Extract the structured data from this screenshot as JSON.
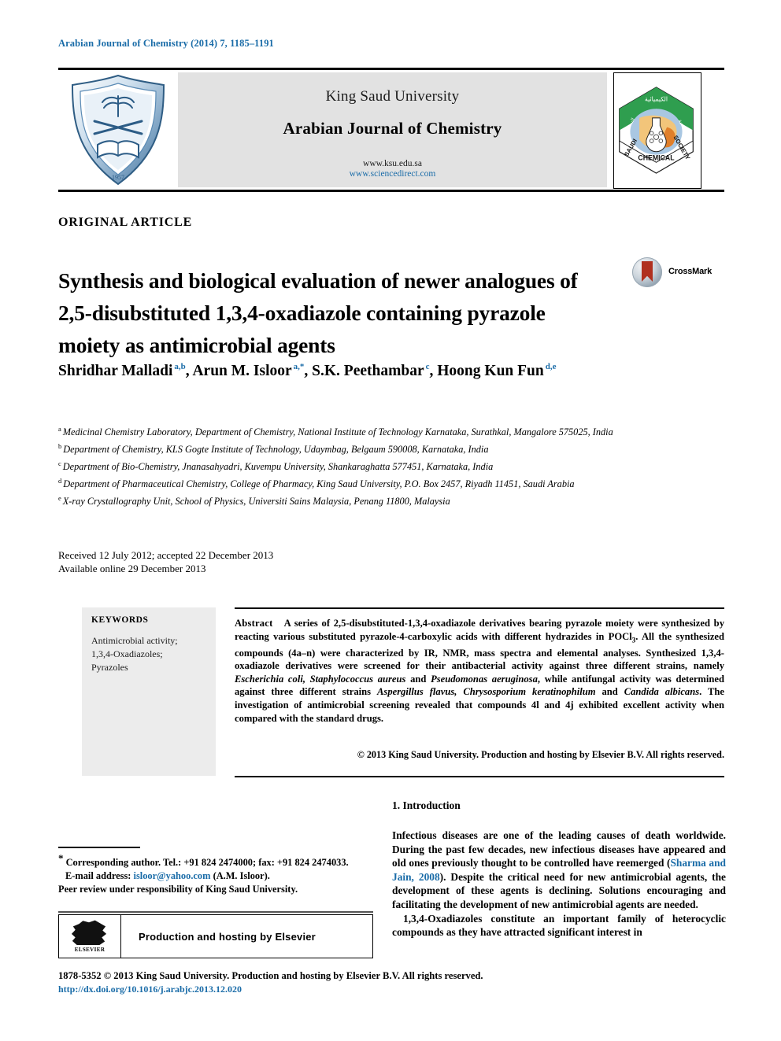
{
  "running_head": "Arabian Journal of Chemistry (2014) 7, 1185–1191",
  "masthead": {
    "publisher": "King Saud University",
    "journal": "Arabian Journal of Chemistry",
    "url_ksu": "www.ksu.edu.sa",
    "url_sciencedirect": "www.sciencedirect.com",
    "left_logo_alt": "king-saud-university-shield",
    "right_logo_alt": "saudi-chemical-society-hexagon",
    "right_logo_text_top": "CHEMICAL",
    "right_logo_text_left": "SAUDI",
    "right_logo_text_right": "SOCIETY"
  },
  "article_type": "ORIGINAL ARTICLE",
  "title": "Synthesis and biological evaluation of newer analogues of 2,5-disubstituted 1,3,4-oxadiazole containing pyrazole moiety as antimicrobial agents",
  "crossmark": {
    "label": "CrossMark"
  },
  "authors": [
    {
      "name": "Shridhar Malladi",
      "marks": "a,b",
      "sep": ", "
    },
    {
      "name": "Arun M. Isloor",
      "marks": "a,*",
      "sep": ", "
    },
    {
      "name": "S.K. Peethambar",
      "marks": "c",
      "sep": ", "
    },
    {
      "name": "Hoong Kun Fun",
      "marks": "d,e",
      "sep": ""
    }
  ],
  "affiliations": [
    {
      "mark": "a",
      "text": "Medicinal Chemistry Laboratory, Department of Chemistry, National Institute of Technology Karnataka, Surathkal, Mangalore 575025, India"
    },
    {
      "mark": "b",
      "text": "Department of Chemistry, KLS Gogte Institute of Technology, Udaymbag, Belgaum 590008, Karnataka, India"
    },
    {
      "mark": "c",
      "text": "Department of Bio-Chemistry, Jnanasahyadri, Kuvempu University, Shankaraghatta 577451, Karnataka, India"
    },
    {
      "mark": "d",
      "text": "Department of Pharmaceutical Chemistry, College of Pharmacy, King Saud University, P.O. Box 2457, Riyadh 11451, Saudi Arabia"
    },
    {
      "mark": "e",
      "text": "X-ray Crystallography Unit, School of Physics, Universiti Sains Malaysia, Penang 11800, Malaysia"
    }
  ],
  "dates": {
    "received_accepted": "Received 12 July 2012; accepted 22 December 2013",
    "available_online": "Available online 29 December 2013"
  },
  "keywords": {
    "title": "KEYWORDS",
    "items": [
      "Antimicrobial activity;",
      "1,3,4-Oxadiazoles;",
      "Pyrazoles"
    ]
  },
  "abstract": {
    "heading": "Abstract",
    "body_part_1": "A series of 2,5-disubstituted-1,3,4-oxadiazole derivatives bearing pyrazole moiety were synthesized by reacting various substituted pyrazole-4-carboxylic acids with different hydrazides in POCl",
    "subscript_3": "3",
    "body_part_2": ". All the synthesized compounds (4a–n) were characterized by IR, NMR, mass spectra and elemental analyses. Synthesized 1,3,4-oxadiazole derivatives were screened for their antibacterial activity against three different strains, namely ",
    "italic_1": "Escherichia coli, Staphylococcus aureus",
    "body_part_3": " and ",
    "italic_2": "Pseudomonas aeruginosa",
    "body_part_4": ", while antifungal activity was determined against three different strains ",
    "italic_3": "Aspergillus flavus, Chrysosporium keratinophilum",
    "body_part_5": " and ",
    "italic_4": "Candida albicans",
    "body_part_6": ". The investigation of antimicrobial screening revealed that compounds 4l and 4j exhibited excellent activity when compared with the standard drugs.",
    "copyright": "© 2013 King Saud University. Production and hosting by Elsevier B.V. All rights reserved."
  },
  "introduction": {
    "heading": "1. Introduction",
    "para_1_pre": "Infectious diseases are one of the leading causes of death worldwide. During the past few decades, new infectious diseases have appeared and old ones previously thought to be controlled have reemerged (",
    "citation_1": "Sharma and Jain, 2008",
    "para_1_post": "). Despite the critical need for new antimicrobial agents, the development of these agents is declining. Solutions encouraging and facilitating the development of new antimicrobial agents are needed.",
    "para_2": "1,3,4-Oxadiazoles constitute an important family of heterocyclic compounds as they have attracted significant interest in"
  },
  "footnotes": {
    "corresponding": "Corresponding author. Tel.: +91 824 2474000; fax: +91 824 2474033.",
    "email_label": "E-mail address:",
    "email": "isloor@yahoo.com",
    "email_owner": "(A.M. Isloor).",
    "peer_review": "Peer review under responsibility of King Saud University."
  },
  "elsevier": {
    "wordmark": "ELSEVIER",
    "text": "Production and hosting by Elsevier"
  },
  "page_footer": {
    "issn_line": "1878-5352 © 2013 King Saud University. Production and hosting by Elsevier B.V. All rights reserved.",
    "doi": "http://dx.doi.org/10.1016/j.arabjc.2013.12.020"
  },
  "colors": {
    "link": "#1a6ca8",
    "panel_gray": "#ececec",
    "masthead_gray": "#e2e2e2"
  }
}
